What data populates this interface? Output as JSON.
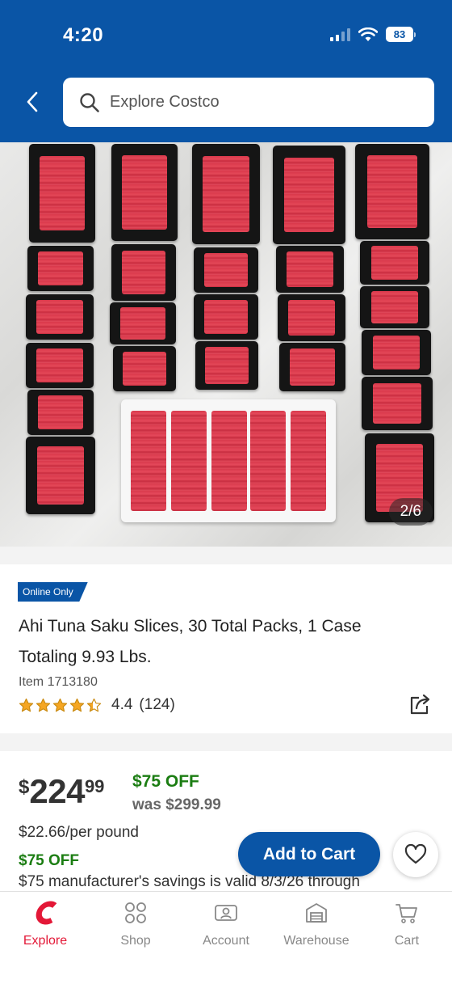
{
  "status_bar": {
    "time": "4:20",
    "battery": "83"
  },
  "search": {
    "placeholder": "Explore Costco"
  },
  "gallery": {
    "counter": "2/6"
  },
  "product": {
    "badge": "Online Only",
    "title": "Ahi Tuna Saku Slices, 30 Total Packs, 1 Case Totaling 9.93 Lbs.",
    "item_number": "Item 1713180",
    "rating_value": "4.4",
    "rating_count": "(124)",
    "rating_stars": 4.4
  },
  "pricing": {
    "currency": "$",
    "price_dollars": "224",
    "price_cents": "99",
    "discount_label": "$75 OFF",
    "was_price": "was $299.99",
    "unit_price": "$22.66/per pound",
    "discount_label_2": "$75 OFF",
    "manufacturer_note": "$75 manufacturer's savings is valid 8/3/26 through"
  },
  "actions": {
    "add_to_cart": "Add to Cart"
  },
  "bottom_nav": {
    "items": [
      {
        "label": "Explore",
        "icon": "costco-c-icon",
        "active": true
      },
      {
        "label": "Shop",
        "icon": "grid-circles-icon",
        "active": false
      },
      {
        "label": "Account",
        "icon": "account-card-icon",
        "active": false
      },
      {
        "label": "Warehouse",
        "icon": "warehouse-icon",
        "active": false
      },
      {
        "label": "Cart",
        "icon": "cart-icon",
        "active": false
      }
    ]
  },
  "colors": {
    "brand_blue": "#0a55a6",
    "brand_red": "#e31837",
    "savings_green": "#1b7d12",
    "star_gold": "#f5a623"
  }
}
